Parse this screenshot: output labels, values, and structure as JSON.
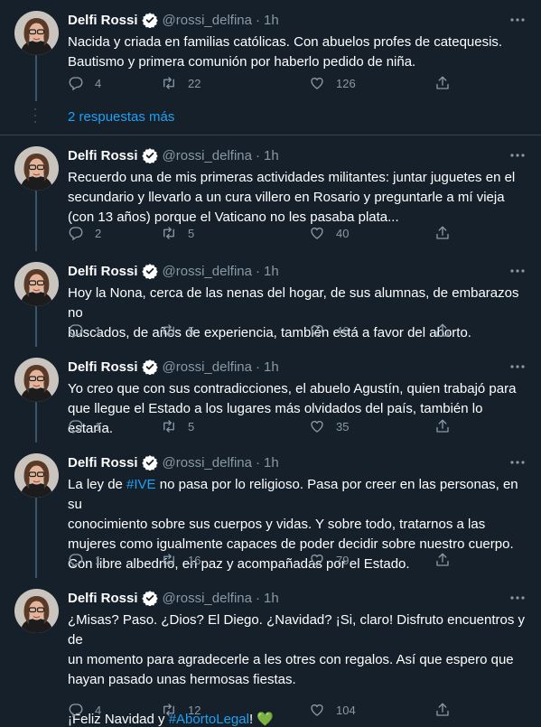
{
  "author": {
    "name": "Delfi Rossi",
    "handle": "@rossi_delfina",
    "dot": "·",
    "verified_color": "#1da1f2"
  },
  "colors": {
    "bg": "#15202b",
    "text": "#ffffff",
    "muted": "#8899a6",
    "accent": "#1da1f2",
    "border": "#38444d"
  },
  "more_replies_label": "2 respuestas más",
  "tweets": [
    {
      "time": "1h",
      "lines": [
        "Nacida y criada en familias católicas. Con abuelos profes de catequesis.",
        "Bautismo y primera comunión por haberlo pedido de niña."
      ],
      "replies": "4",
      "retweets": "22",
      "likes": "126"
    },
    {
      "time": "1h",
      "lines": [
        "Recuerdo una de mis primeras actividades militantes: juntar juguetes en el",
        "secundario y llevarlo a un cura villero en Rosario y preguntarle a mí vieja",
        "(con 13 años) porque el Vaticano no les pasaba plata..."
      ],
      "replies": "2",
      "retweets": "5",
      "likes": "40"
    },
    {
      "time": "1h",
      "lines": [
        "Hoy la Nona, cerca de las nenas del hogar, de sus alumnas, de embarazos no",
        "buscados, de años de experiencia, también está a favor del aborto."
      ],
      "replies": "1",
      "retweets": "5",
      "likes": "46"
    },
    {
      "time": "1h",
      "lines": [
        "Yo creo que con sus contradicciones, el abuelo Agustín, quien trabajó para",
        "que llegue el Estado a los lugares más olvidados del país, también lo estaría."
      ],
      "replies": "1",
      "retweets": "5",
      "likes": "35"
    },
    {
      "time": "1h",
      "line1_pre": "La ley de ",
      "line1_tag": "#IVE",
      "line1_post": " no pasa por lo religioso. Pasa por creer en las personas, en su",
      "lines": [
        "conocimiento sobre sus cuerpos y vidas. Y sobre todo, tratarnos a las",
        "mujeres como igualmente capaces de poder decidir sobre nuestro cuerpo.",
        "Con libre albedrío, en paz y acompañadas por el Estado."
      ],
      "replies": "1",
      "retweets": "16",
      "likes": "79"
    },
    {
      "time": "1h",
      "lines": [
        "¿Misas? Paso. ¿Dios? El Diego. ¿Navidad? ¡Si, claro! Disfruto encuentros y de",
        "un momento para agradecerle a les otres con regalos. Así que espero que",
        "hayan pasado unas hermosas fiestas."
      ],
      "last_pre": "¡Feliz Navidad y ",
      "last_tag": "#AbortoLegal",
      "last_post": "! ",
      "last_emoji": "💚",
      "replies": "4",
      "retweets": "12",
      "likes": "104"
    }
  ]
}
